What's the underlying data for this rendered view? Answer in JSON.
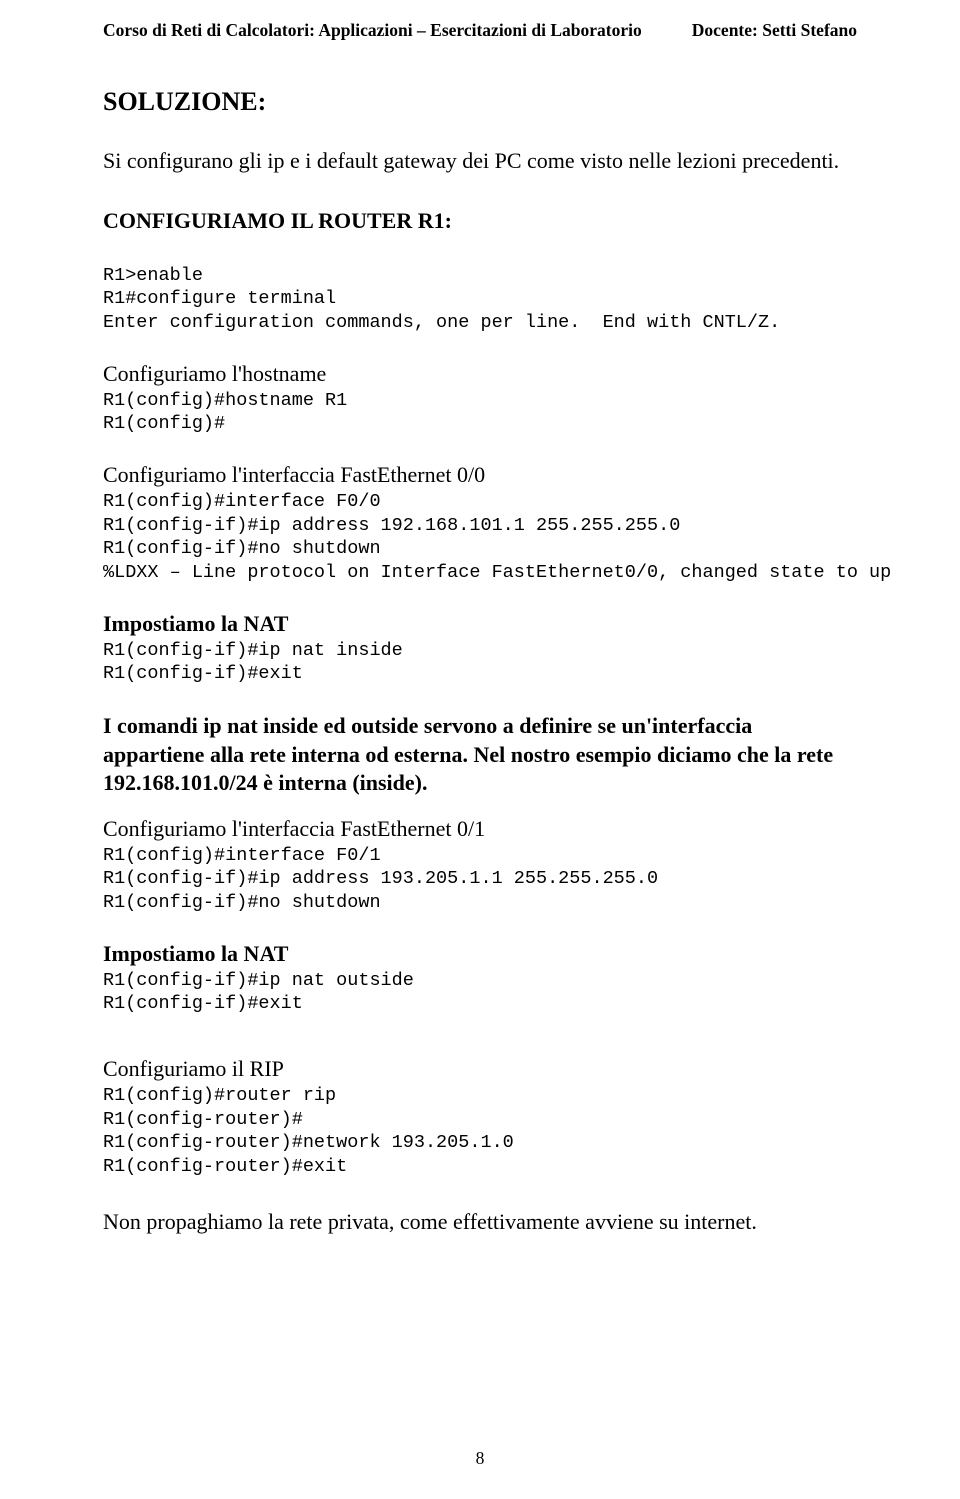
{
  "header": {
    "left": "Corso di Reti di Calcolatori: Applicazioni – Esercitazioni di Laboratorio",
    "right": "Docente: Setti  Stefano"
  },
  "soluzione_title": "SOLUZIONE:",
  "intro_text": "Si configurano gli ip e i default gateway dei PC come visto nelle lezioni precedenti.",
  "configuriamo_title": "CONFIGURIAMO IL ROUTER R1:",
  "block1": "R1>enable\nR1#configure terminal\nEnter configuration commands, one per line.  End with CNTL/Z.",
  "hostname_intro": "Configuriamo l'hostname",
  "block2": "R1(config)#hostname R1\nR1(config)#",
  "fe00_intro": "Configuriamo l'interfaccia FastEthernet 0/0",
  "block3": "R1(config)#interface F0/0\nR1(config-if)#ip address 192.168.101.1 255.255.255.0\nR1(config-if)#no shutdown\n%LDXX – Line protocol on Interface FastEthernet0/0, changed state to up",
  "nat1_title": "Impostiamo la NAT",
  "block4": "R1(config-if)#ip nat inside\nR1(config-if)#exit",
  "nat_body": "I comandi ip nat inside ed outside servono a definire se un'interfaccia appartiene alla rete interna od esterna. Nel nostro esempio diciamo che la rete 192.168.101.0/24 è interna (inside).",
  "fe01_intro": "Configuriamo l'interfaccia FastEthernet 0/1",
  "block5": "R1(config)#interface F0/1\nR1(config-if)#ip address 193.205.1.1 255.255.255.0\nR1(config-if)#no shutdown",
  "nat2_title": "Impostiamo la NAT",
  "block6": "R1(config-if)#ip nat outside\nR1(config-if)#exit",
  "rip_intro": "Configuriamo il RIP",
  "block7": "R1(config)#router rip\nR1(config-router)#\nR1(config-router)#network 193.205.1.0\nR1(config-router)#exit",
  "last_line": "Non propaghiamo la rete privata, come effettivamente avviene su internet.",
  "page_number": "8"
}
